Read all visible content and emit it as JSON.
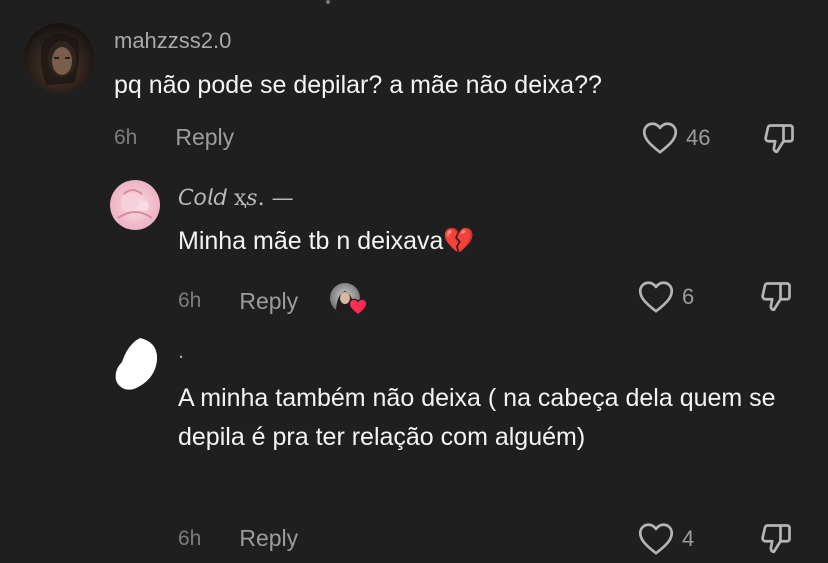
{
  "comments": [
    {
      "username": "mahzzss2.0",
      "text": "pq não pode se depilar? a mãe não deixa??",
      "time": "6h",
      "reply_label": "Reply",
      "likes": "46"
    },
    {
      "username": "𝘊𝘰𝘭𝘥 ҳ𝑠. —",
      "text": "Minha mãe tb n deixava💔",
      "time": "6h",
      "reply_label": "Reply",
      "likes": "6"
    },
    {
      "username": ".",
      "text": "A minha também não deixa ( na cabeça dela quem se depila é pra ter relação com alguém)",
      "time": "6h",
      "reply_label": "Reply",
      "likes": "4"
    }
  ],
  "icons": {
    "like": "heart-outline-icon",
    "dislike": "thumbs-down-outline-icon"
  },
  "colors": {
    "background": "#1f1f1f",
    "primary_text": "#f4f4f4",
    "secondary_text": "#9c9c9c",
    "heart_badge": "#ff2d55"
  }
}
